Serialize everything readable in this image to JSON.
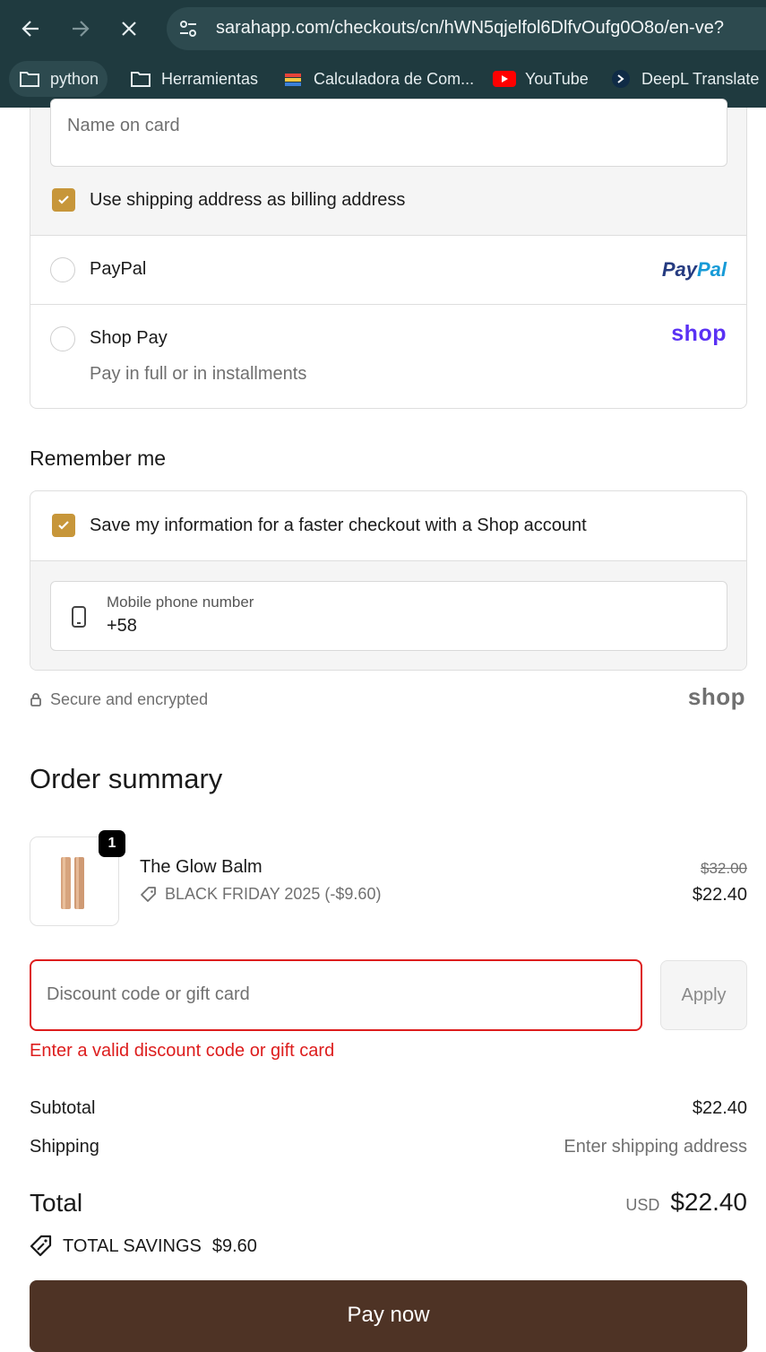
{
  "browser": {
    "url": "sarahapp.com/checkouts/cn/hWN5qjelfol6DlfvOufg0O8o/en-ve?",
    "bookmarks": [
      {
        "label": "python",
        "icon": "folder-icon"
      },
      {
        "label": "Herramientas",
        "icon": "folder-icon"
      },
      {
        "label": "Calculadora de Com...",
        "icon": "calculator-favicon"
      },
      {
        "label": "YouTube",
        "icon": "youtube-icon"
      },
      {
        "label": "DeepL Translate",
        "icon": "deepl-icon"
      }
    ]
  },
  "payment": {
    "name_on_card_placeholder": "Name on card",
    "billing_same_label": "Use shipping address as billing address",
    "paypal_label": "PayPal",
    "paypal_logo": "PayPal",
    "shoppay_label": "Shop Pay",
    "shoppay_sub": "Pay in full or in installments",
    "shop_logo": "shop"
  },
  "remember": {
    "heading": "Remember me",
    "save_label": "Save my information for a faster checkout with a Shop account",
    "phone_label": "Mobile phone number",
    "phone_value": "+58",
    "secure_text": "Secure and encrypted",
    "shop_logo": "shop"
  },
  "order": {
    "heading": "Order summary",
    "item": {
      "quantity": "1",
      "name": "The Glow Balm",
      "discount": "BLACK FRIDAY 2025 (-$9.60)",
      "original_price": "$32.00",
      "price": "$22.40"
    },
    "discount_placeholder": "Discount code or gift card",
    "apply_label": "Apply",
    "error": "Enter a valid discount code or gift card",
    "subtotal_label": "Subtotal",
    "subtotal_value": "$22.40",
    "shipping_label": "Shipping",
    "shipping_value": "Enter shipping address",
    "total_label": "Total",
    "currency": "USD",
    "total_value": "$22.40",
    "savings_label": "TOTAL SAVINGS",
    "savings_value": "$9.60",
    "pay_label": "Pay now"
  },
  "colors": {
    "accent": "#c7963a",
    "error": "#dd1d1d",
    "pay_button": "#4e3325",
    "paypal_dark": "#253b80",
    "paypal_light": "#179bd7",
    "shop_purple": "#5a31f4"
  }
}
